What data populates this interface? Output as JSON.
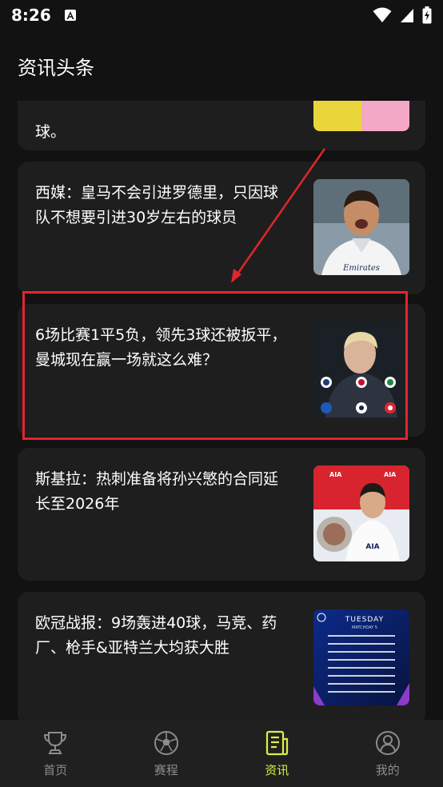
{
  "status_bar": {
    "time": "8:26"
  },
  "header": {
    "title": "资讯头条"
  },
  "news": [
    {
      "title": "球。"
    },
    {
      "title": "西媒：皇马不会引进罗德里，只因球队不想要引进30岁左右的球员"
    },
    {
      "title": "6场比赛1平5负，领先3球还被扳平，曼城现在赢一场就这么难？"
    },
    {
      "title": "斯基拉：热刺准备将孙兴慜的合同延长至2026年"
    },
    {
      "title": "欧冠战报：9场轰进40球，马竞、药厂、枪手&亚特兰大均获大胜"
    }
  ],
  "thumb_text": {
    "sponsor": "Emirates",
    "aia": "AIA",
    "tuesday": "TUESDAY",
    "matchday": "MATCHDAY 5"
  },
  "nav": [
    {
      "label": "首页",
      "icon": "trophy-icon"
    },
    {
      "label": "赛程",
      "icon": "football-icon"
    },
    {
      "label": "资讯",
      "icon": "news-icon"
    },
    {
      "label": "我的",
      "icon": "profile-icon"
    }
  ],
  "colors": {
    "accent": "#d8f045",
    "annotation": "#e0262d",
    "card": "#1e1e1e",
    "background": "#121212"
  }
}
